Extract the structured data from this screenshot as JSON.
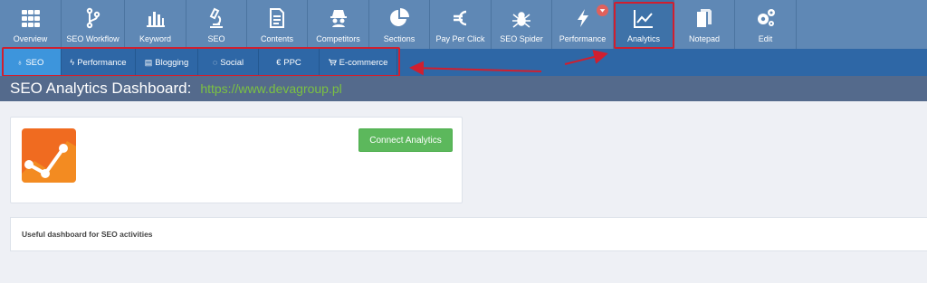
{
  "toolbar": {
    "items": [
      {
        "label": "Overview",
        "icon": "grid-icon"
      },
      {
        "label": "SEO Workflow",
        "icon": "workflow-icon"
      },
      {
        "label": "Keyword",
        "icon": "bar-chart-icon"
      },
      {
        "label": "SEO",
        "icon": "microscope-icon"
      },
      {
        "label": "Contents",
        "icon": "document-icon"
      },
      {
        "label": "Competitors",
        "icon": "spy-icon"
      },
      {
        "label": "Sections",
        "icon": "pie-chart-icon"
      },
      {
        "label": "Pay Per Click",
        "icon": "euro-icon"
      },
      {
        "label": "SEO Spider",
        "icon": "spider-icon"
      },
      {
        "label": "Performance",
        "icon": "bolt-icon"
      },
      {
        "label": "Analytics",
        "icon": "line-chart-icon"
      },
      {
        "label": "Notepad",
        "icon": "notepad-icon"
      },
      {
        "label": "Edit",
        "icon": "gears-icon"
      }
    ],
    "active": "Analytics"
  },
  "subnav": {
    "items": [
      {
        "label": "SEO",
        "icon": "microscope-icon"
      },
      {
        "label": "Performance",
        "icon": "bolt-icon"
      },
      {
        "label": "Blogging",
        "icon": "document-icon"
      },
      {
        "label": "Social",
        "icon": "chat-icon"
      },
      {
        "label": "PPC",
        "icon": "euro-icon"
      },
      {
        "label": "E-commerce",
        "icon": "cart-icon"
      }
    ],
    "active": "SEO"
  },
  "page": {
    "title": "SEO Analytics Dashboard:",
    "url": "https://www.devagroup.pl"
  },
  "card": {
    "logo": "google-analytics-logo",
    "connect_label": "Connect Analytics"
  },
  "info": {
    "text": "Useful dashboard for SEO activities"
  },
  "colors": {
    "toolbar_bg": "#5f88b5",
    "subnav_bg": "#2e67a6",
    "subnav_active": "#3d95dc",
    "title_bg": "#546a8c",
    "url": "#7bc142",
    "connect_button": "#5cb85c",
    "highlight": "#d01f2f",
    "logo": "#f06b20"
  }
}
